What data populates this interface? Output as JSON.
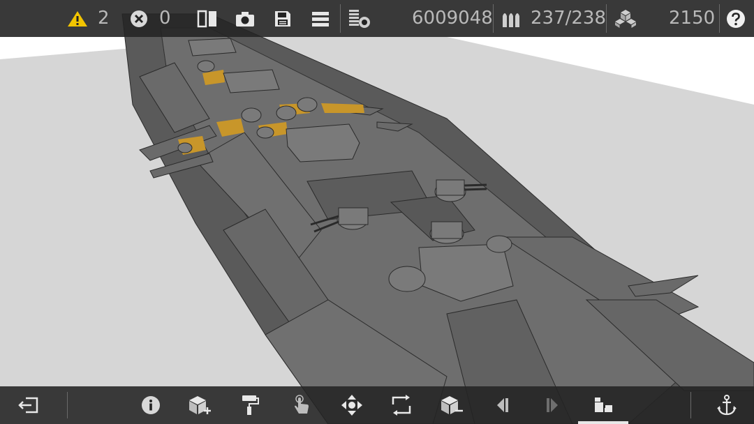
{
  "status": {
    "warnings_count": "2",
    "errors_count": "0",
    "cost_value": "6009048",
    "ammo_value": "237/238",
    "blocks_value": "2150"
  },
  "colors": {
    "bar_bg": "#232323",
    "warning_icon": "#f2c400",
    "text": "#b9b9b9",
    "icon": "#e8e8e8",
    "hull": "#6b6b6b",
    "deck": "#5f5f5f",
    "accent_deck": "#c8962a",
    "sky": "#d6d6d6"
  },
  "top_icons": [
    "warning-icon",
    "error-icon",
    "mirror-icon",
    "camera-icon",
    "save-icon",
    "menu-icon",
    "cost-icon",
    "ammo-icon",
    "blocks-icon",
    "help-icon"
  ],
  "bottom_icons": [
    "exit-icon",
    "info-icon",
    "add-block-icon",
    "paint-roller-icon",
    "touch-select-icon",
    "move-icon",
    "rotate-icon",
    "remove-block-icon",
    "prev-icon",
    "next-icon",
    "weapons-mode-icon",
    "anchor-icon"
  ]
}
